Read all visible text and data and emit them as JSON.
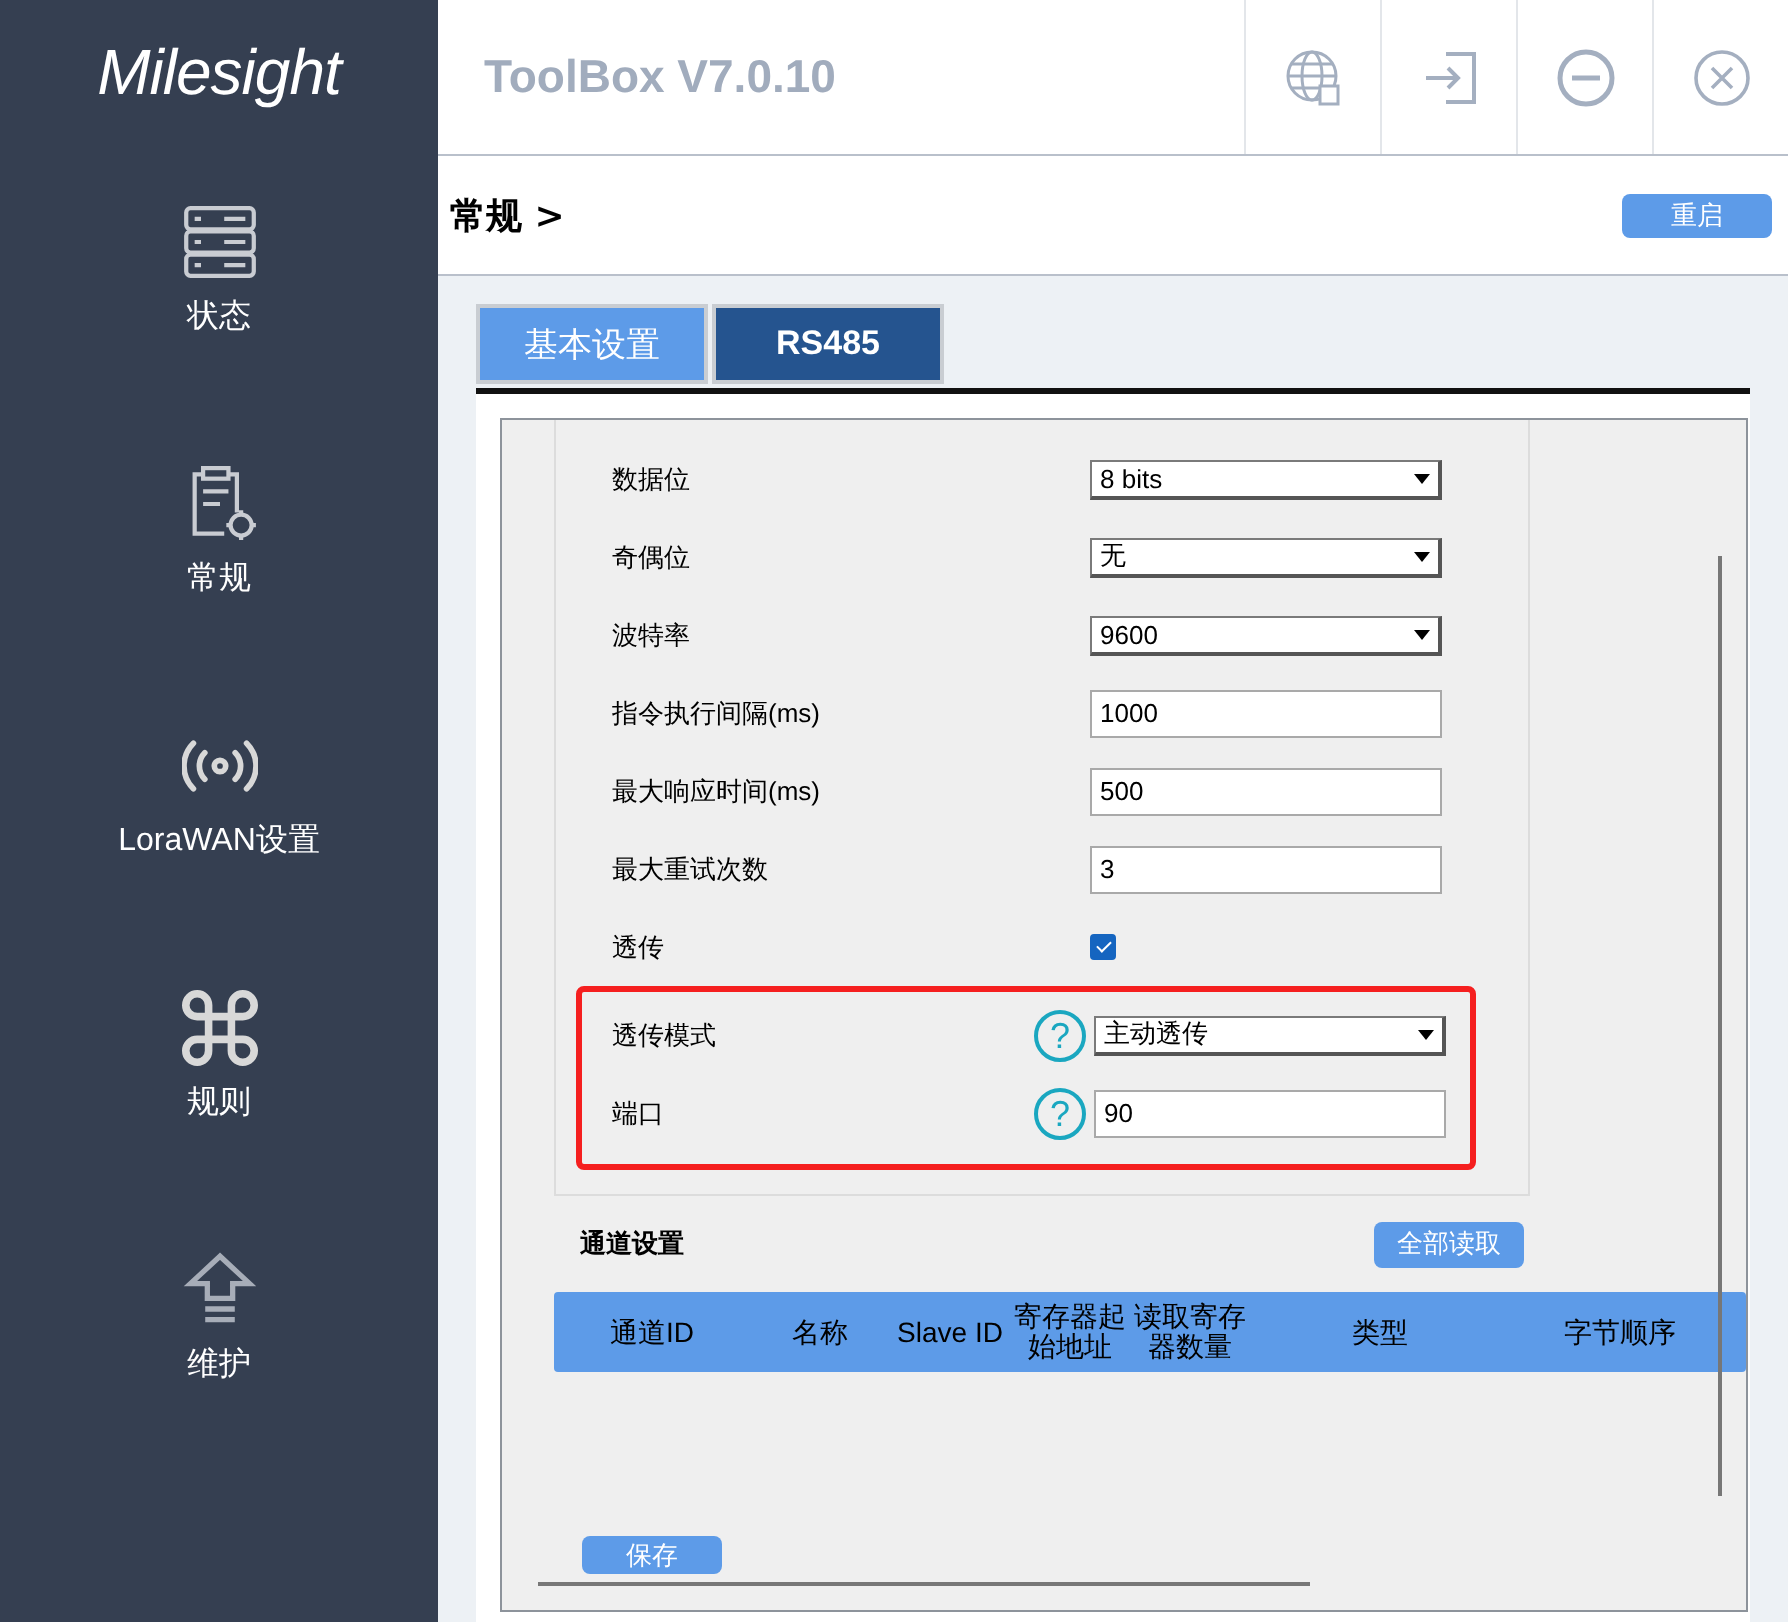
{
  "sidebar": {
    "logo": "Milesight",
    "items": [
      {
        "label": "状态"
      },
      {
        "label": "常规"
      },
      {
        "label": "LoraWAN设置"
      },
      {
        "label": "规则"
      },
      {
        "label": "维护"
      }
    ]
  },
  "header": {
    "title": "ToolBox V7.0.10"
  },
  "breadcrumb": {
    "text": "常规 >",
    "button": "重启"
  },
  "tabs": [
    {
      "label": "基本设置",
      "selected": false
    },
    {
      "label": "RS485",
      "selected": true
    }
  ],
  "form": {
    "rows": [
      {
        "kind": "select",
        "label": "数据位",
        "value": "8 bits"
      },
      {
        "kind": "select",
        "label": "奇偶位",
        "value": "无"
      },
      {
        "kind": "select",
        "label": "波特率",
        "value": "9600"
      },
      {
        "kind": "input",
        "label": "指令执行间隔(ms)",
        "value": "1000"
      },
      {
        "kind": "input",
        "label": "最大响应时间(ms)",
        "value": "500"
      },
      {
        "kind": "input",
        "label": "最大重试次数",
        "value": "3"
      },
      {
        "kind": "checkbox",
        "label": "透传",
        "checked": true
      }
    ],
    "highlighted_rows": [
      {
        "kind": "select",
        "label": "透传模式",
        "value": "主动透传",
        "help": "?"
      },
      {
        "kind": "input",
        "label": "端口",
        "value": "90",
        "help": "?"
      }
    ]
  },
  "channels": {
    "title": "通道设置",
    "button": "全部读取",
    "columns": [
      "通道ID",
      "名称",
      "Slave ID",
      "寄存器起始地址",
      "读取寄存器数量",
      "类型",
      "字节顺序"
    ],
    "save_button": "保存"
  }
}
